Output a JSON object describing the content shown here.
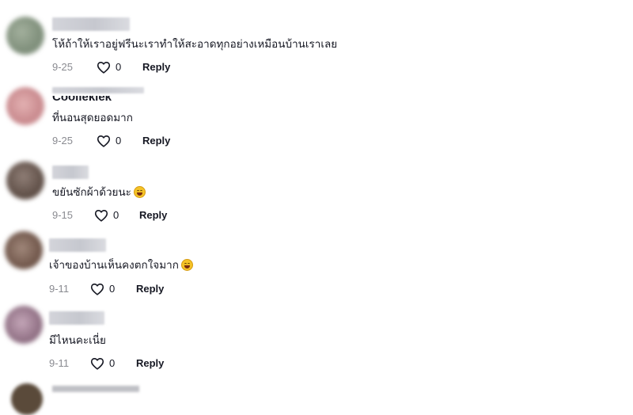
{
  "comments": [
    {
      "text": "โห้ถ้าให้เราอยู่ฟรีนะเราทำให้สะอาดทุกอย่างเหมือนบ้านเราเลย",
      "date": "9-25",
      "likes": "0",
      "reply_label": "Reply",
      "avatar_color": "#8a9a86"
    },
    {
      "username_partial": "Coolleklek",
      "text": "ที่นอนสุดยอดมาก",
      "date": "9-25",
      "likes": "0",
      "reply_label": "Reply",
      "avatar_color": "#d8a4a6"
    },
    {
      "text": "ขยันซักผ้าด้วยนะ",
      "date": "9-15",
      "likes": "0",
      "reply_label": "Reply",
      "avatar_color": "#7a6860"
    },
    {
      "text": "เจ้าของบ้านเห็นคงตกใจมาก",
      "date": "9-11",
      "likes": "0",
      "reply_label": "Reply",
      "avatar_color": "#8e7468"
    },
    {
      "text": "มีไหนคะเนี่ย",
      "date": "9-11",
      "likes": "0",
      "reply_label": "Reply",
      "avatar_color": "#a88a9e"
    }
  ],
  "icons": {
    "like": "heart-outline-icon",
    "emoji_1": "grinning-sweat-emoji",
    "emoji_2": "grinning-sweat-emoji"
  }
}
